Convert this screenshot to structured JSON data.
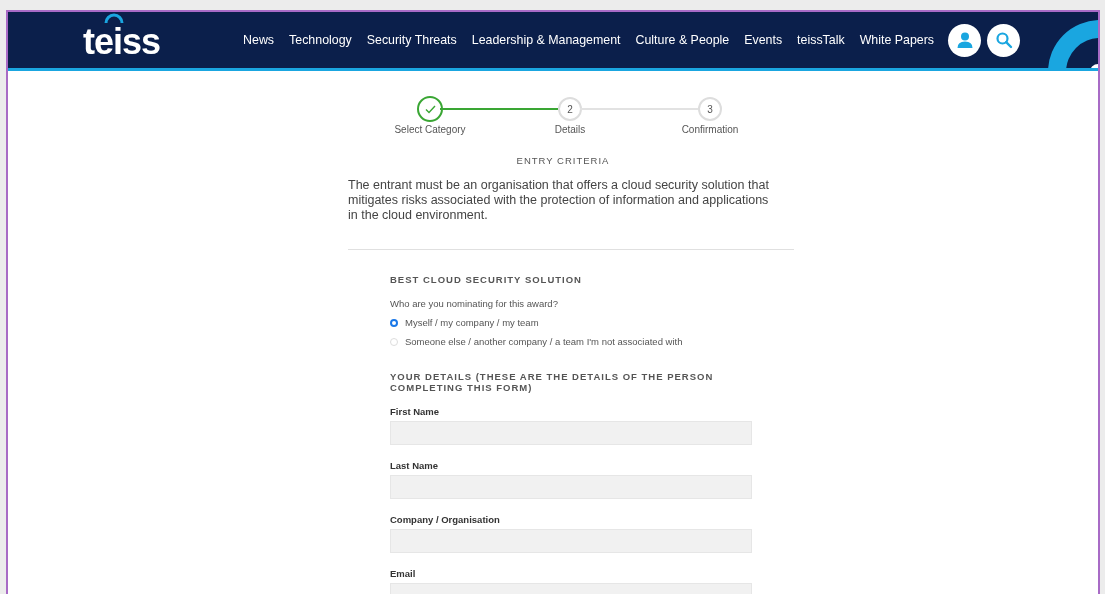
{
  "header": {
    "logo": "teiss",
    "nav": [
      "News",
      "Technology",
      "Security Threats",
      "Leadership & Management",
      "Culture & People",
      "Events",
      "teissTalk",
      "White Papers"
    ]
  },
  "stepper": [
    {
      "label": "Select Category",
      "done": true
    },
    {
      "number": "2",
      "label": "Details",
      "done": false
    },
    {
      "number": "3",
      "label": "Confirmation",
      "done": false
    }
  ],
  "criteria": {
    "heading": "ENTRY CRITERIA",
    "text": "The entrant must be an organisation that offers a cloud security solution that mitigates risks associated with the protection of information and applications in the cloud environment."
  },
  "form": {
    "title": "BEST CLOUD SECURITY SOLUTION",
    "question": "Who are you nominating for this award?",
    "options": [
      {
        "label": "Myself / my company / my team",
        "selected": true
      },
      {
        "label": "Someone else / another company / a team I'm not associated with",
        "selected": false
      }
    ],
    "details_heading": "YOUR DETAILS (THESE ARE THE DETAILS OF THE PERSON COMPLETING THIS FORM)",
    "fields": [
      {
        "label": "First Name"
      },
      {
        "label": "Last Name"
      },
      {
        "label": "Company / Organisation"
      },
      {
        "label": "Email"
      }
    ]
  }
}
